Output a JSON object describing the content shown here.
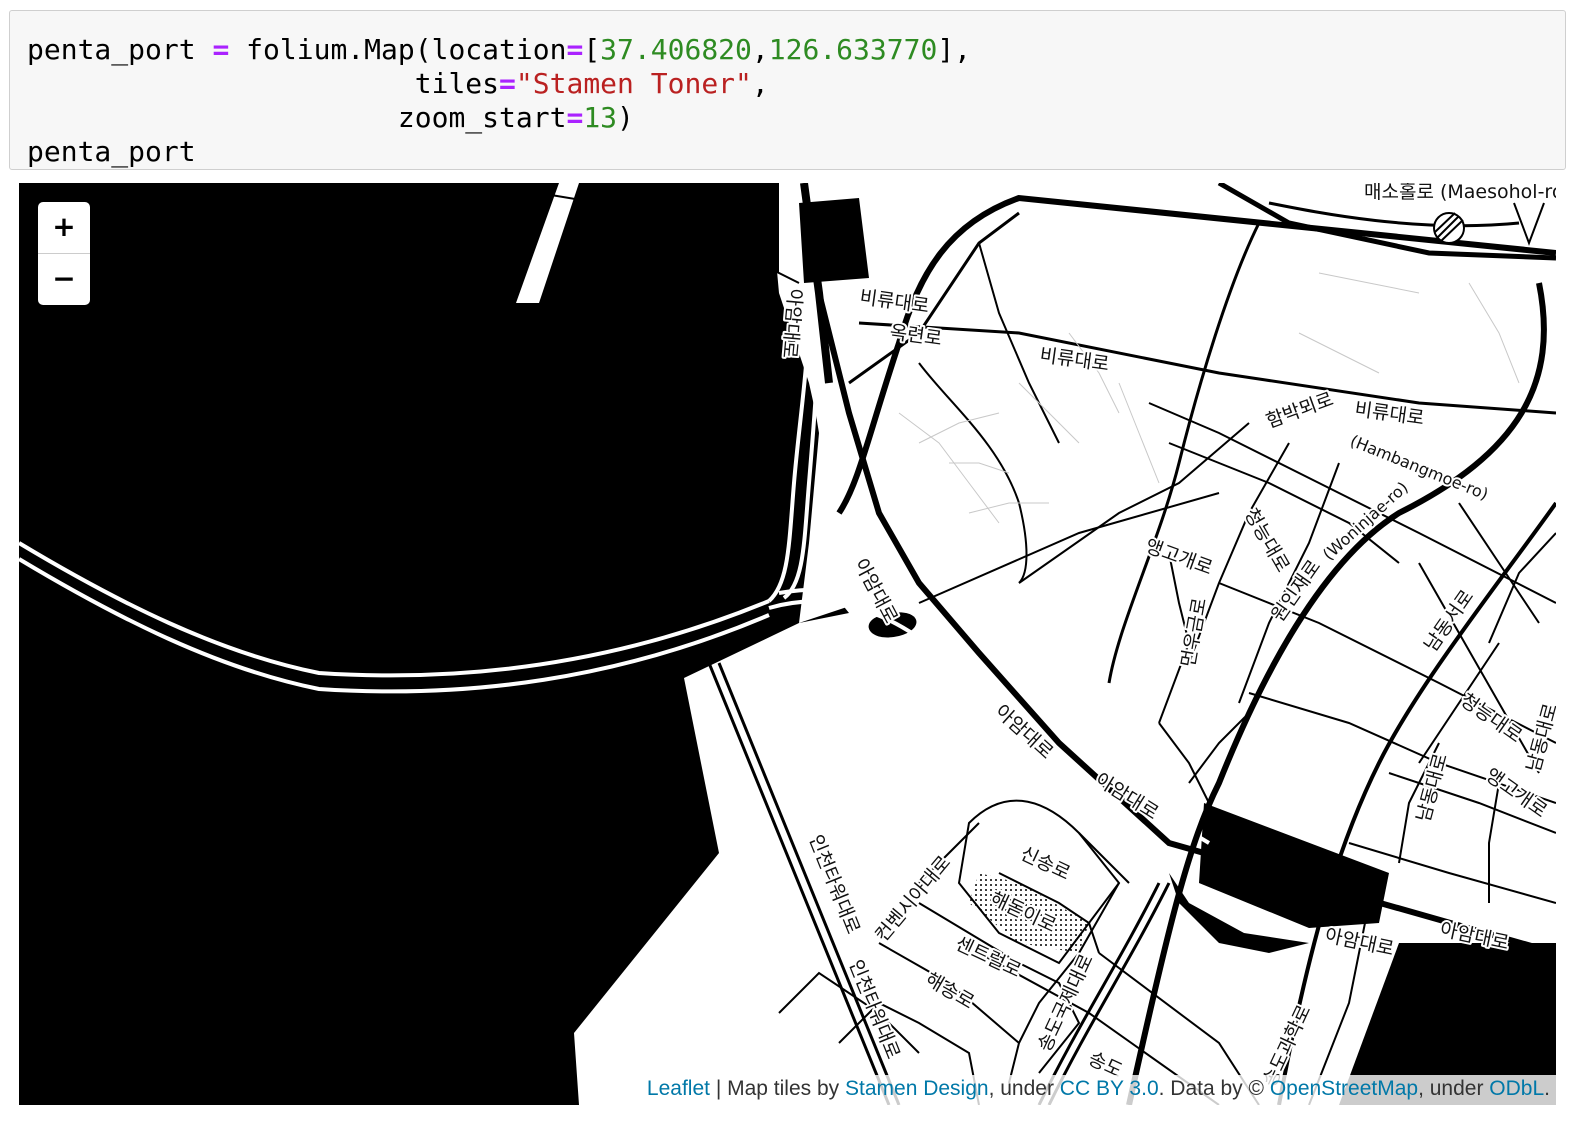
{
  "code_cell": {
    "lines": [
      [
        "penta_port ",
        "=",
        " folium.Map(location",
        "=",
        "[",
        "37.406820",
        ",",
        "126.633770",
        "],"
      ],
      [
        "                        tiles",
        "=",
        "\"Stamen Toner\"",
        ","
      ],
      [
        "                       zoom_start",
        "=",
        "13",
        ")"
      ],
      [
        "penta_port"
      ]
    ],
    "var": "penta_port",
    "call": "folium.Map(location",
    "lat": "37.406820",
    "lon": "126.633770",
    "tiles_kw": "tiles",
    "tiles_val": "\"Stamen Toner\"",
    "zoom_kw": "zoom_start",
    "zoom_val": "13",
    "output_line": "penta_port"
  },
  "map": {
    "center": {
      "lat": 37.40682,
      "lon": 126.63377
    },
    "zoom": 13,
    "tiles": "Stamen Toner",
    "zoom_in_label": "+",
    "zoom_out_label": "−",
    "labels": {
      "maesohol": "매소홀로 (Maesohol-ro",
      "biryudaero_1": "비류대로",
      "biryudaero_2": "비류대로",
      "biryudaero_3": "비류대로",
      "okryeonro": "옥련로",
      "aamdaero_v": "아암대로",
      "hambangmoe_ko": "함박뫼로",
      "hambangmoe_en": "(Hambangmoe-ro)",
      "aamdaero_1": "아암대로",
      "aamdaero_2": "아암대로",
      "aamdaero_3": "아암대로",
      "aamdaero_4": "아암대로",
      "aamdaero_5": "아암대로",
      "aenggogaero_1": "앵고개로",
      "aenggogaero_2": "앵고개로",
      "cheongneungdaero_1": "청능대로",
      "cheongneungdaero_2": "청능대로",
      "woninjaero_ko": "원인재로",
      "woninjaero_en": "(Woninjae-ro)",
      "yeonugeumro": "먼우금로",
      "namdongseoro": "남동서로",
      "namdongdaero_1": "남동대로",
      "namdongdaero_2": "남동대로",
      "sinsongro": "신송로",
      "haedoji": "해돋이로",
      "centralro": "센트럴로",
      "convensia": "컨벤시아대로",
      "incheontower_1": "인천타워대로",
      "incheontower_2": "인천타워대로",
      "haesongro": "해송로",
      "songdogukje": "송도국제대로",
      "songdo_partial": "송도",
      "bottom_road": "송도과학로"
    },
    "attribution": {
      "leaflet": "Leaflet",
      "sep": " | Map tiles by ",
      "stamen": "Stamen Design",
      "under1": ", under ",
      "ccby": "CC BY 3.0",
      "databy": ". Data by © ",
      "osm": "OpenStreetMap",
      "under2": ", under ",
      "odbl": "ODbL",
      "end": "."
    }
  }
}
